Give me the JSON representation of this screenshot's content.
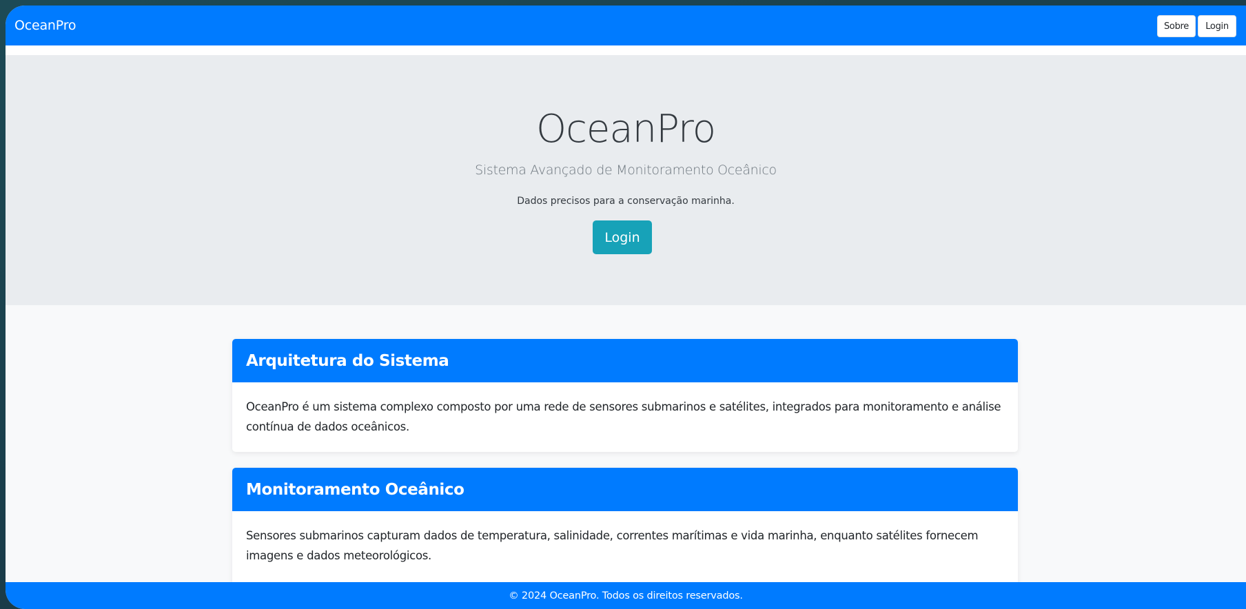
{
  "navbar": {
    "brand": "OceanPro",
    "buttons": [
      {
        "label": "Sobre"
      },
      {
        "label": "Login"
      }
    ]
  },
  "hero": {
    "title": "OceanPro",
    "subtitle": "Sistema Avançado de Monitoramento Oceânico",
    "tagline": "Dados precisos para a conservação marinha.",
    "button_label": "Login"
  },
  "cards": [
    {
      "title": "Arquitetura do Sistema",
      "body": "OceanPro é um sistema complexo composto por uma rede de sensores submarinos e satélites, integrados para monitoramento e análise contínua de dados oceânicos."
    },
    {
      "title": "Monitoramento Oceânico",
      "body": "Sensores submarinos capturam dados de temperatura, salinidade, correntes marítimas e vida marinha, enquanto satélites fornecem imagens e dados meteorológicos."
    }
  ],
  "footer": {
    "text": "© 2024 OceanPro. Todos os direitos reservados."
  },
  "colors": {
    "primary": "#007bff",
    "info": "#17a2b8",
    "hero_bg": "#e9ecef",
    "page_bg": "#f8f9fa"
  }
}
